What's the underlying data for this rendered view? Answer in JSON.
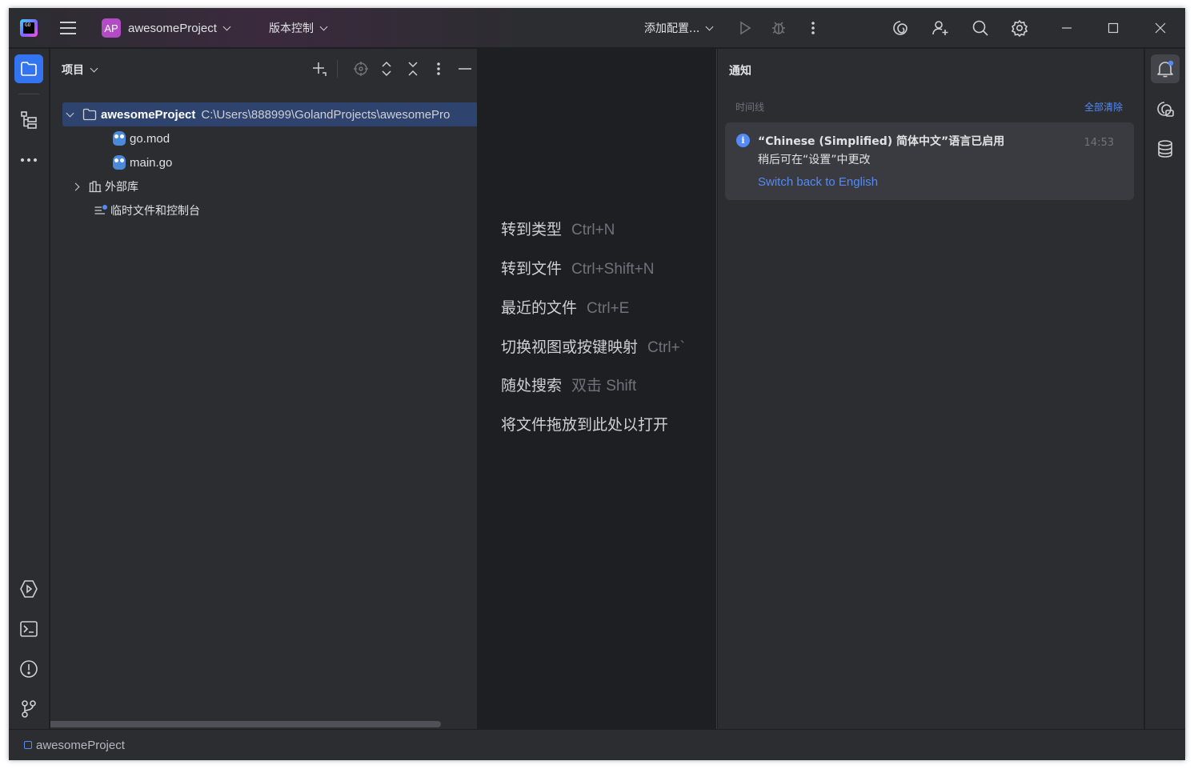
{
  "titlebar": {
    "logo_text": "GO",
    "project_badge": "AP",
    "project_name": "awesomeProject",
    "vcs_label": "版本控制",
    "run_config_label": "添加配置..."
  },
  "project_panel": {
    "title": "项目",
    "tree": [
      {
        "label": "awesomeProject",
        "path": "C:\\Users\\888999\\GolandProjects\\awesomePro"
      },
      {
        "label": "go.mod"
      },
      {
        "label": "main.go"
      },
      {
        "label": "外部库"
      },
      {
        "label": "临时文件和控制台"
      }
    ]
  },
  "center_hints": [
    {
      "action": "转到类型",
      "key": "Ctrl+N"
    },
    {
      "action": "转到文件",
      "key": "Ctrl+Shift+N"
    },
    {
      "action": "最近的文件",
      "key": "Ctrl+E"
    },
    {
      "action": "切换视图或按键映射",
      "key": "Ctrl+`"
    },
    {
      "action": "随处搜索",
      "key": "双击 Shift"
    },
    {
      "action": "将文件拖放到此处以打开",
      "key": ""
    }
  ],
  "notifications": {
    "title": "通知",
    "timeline_label": "时间线",
    "clear_all": "全部清除",
    "items": [
      {
        "heading": "“Chinese (Simplified) 简体中文”语言已启用",
        "time": "14:53",
        "body": "稍后可在“设置”中更改",
        "link": "Switch back to English"
      }
    ]
  },
  "statusbar": {
    "breadcrumb": "awesomeProject"
  },
  "colors": {
    "accent": "#3574f0",
    "link": "#548af7",
    "selection": "#2e436e",
    "panel_bg": "#2b2d30",
    "editor_bg": "#1e1f22",
    "project_badge": "#b44bc6"
  }
}
